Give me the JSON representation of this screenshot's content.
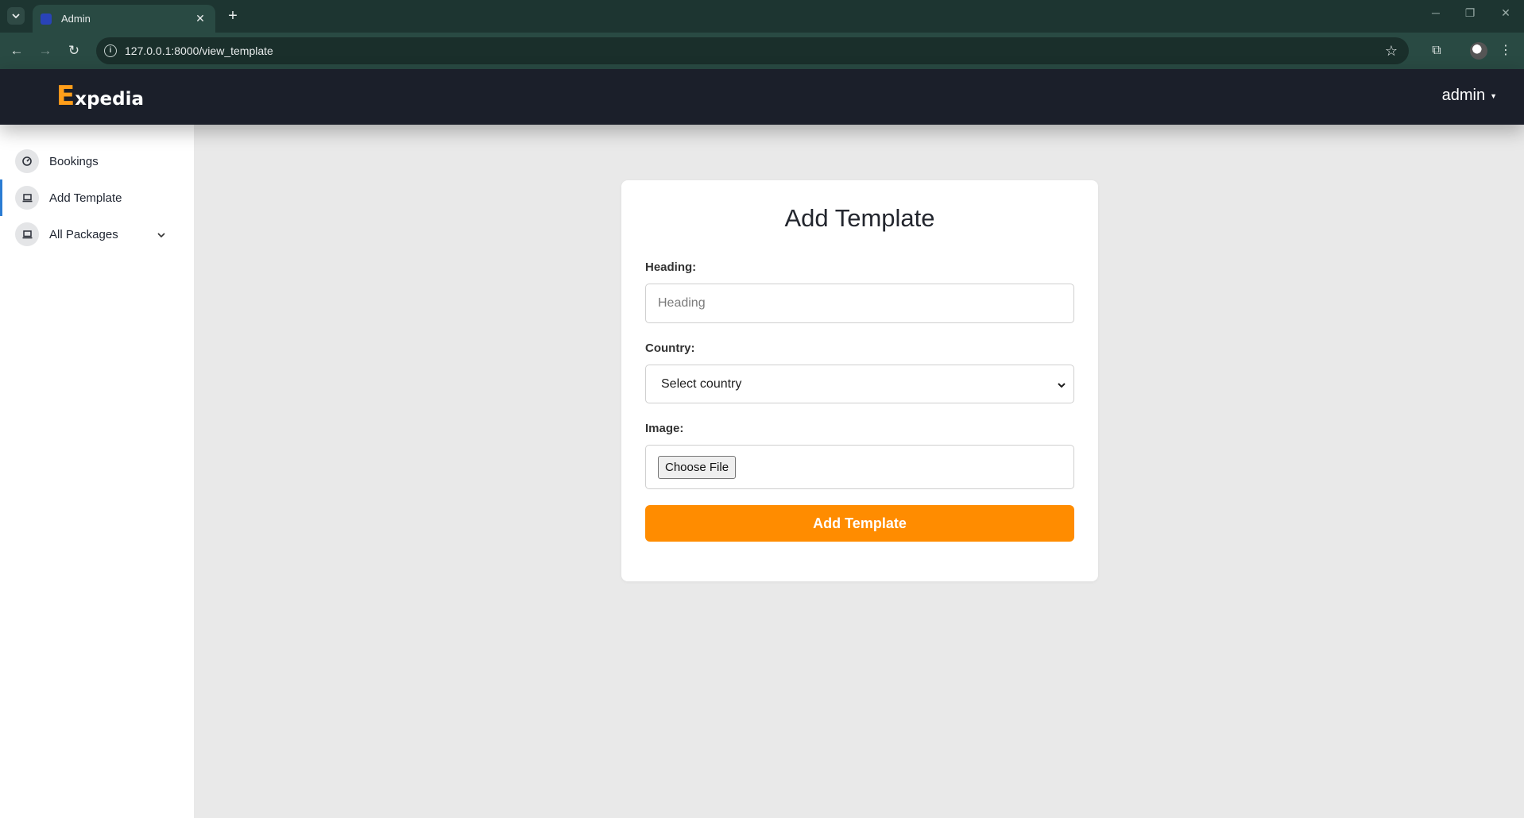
{
  "browser": {
    "tab_title": "Admin",
    "url": "127.0.0.1:8000/view_template"
  },
  "header": {
    "logo_first_letter": "E",
    "logo_rest": "xpedia",
    "user": "admin"
  },
  "sidebar": {
    "items": [
      {
        "label": "Bookings",
        "icon": "dashboard-icon",
        "active": false
      },
      {
        "label": "Add Template",
        "icon": "laptop-icon",
        "active": true
      },
      {
        "label": "All Packages",
        "icon": "laptop-icon",
        "active": false,
        "expandable": true
      }
    ]
  },
  "form": {
    "title": "Add Template",
    "heading_label": "Heading:",
    "heading_placeholder": "Heading",
    "heading_value": "",
    "country_label": "Country:",
    "country_selected": "Select country",
    "image_label": "Image:",
    "file_button": "Choose File",
    "submit_label": "Add Template"
  },
  "colors": {
    "accent": "#ff8c00",
    "logo_accent": "#ff9e1a",
    "header_bg": "#1b1f2a",
    "active_indicator": "#2b7cd3"
  }
}
